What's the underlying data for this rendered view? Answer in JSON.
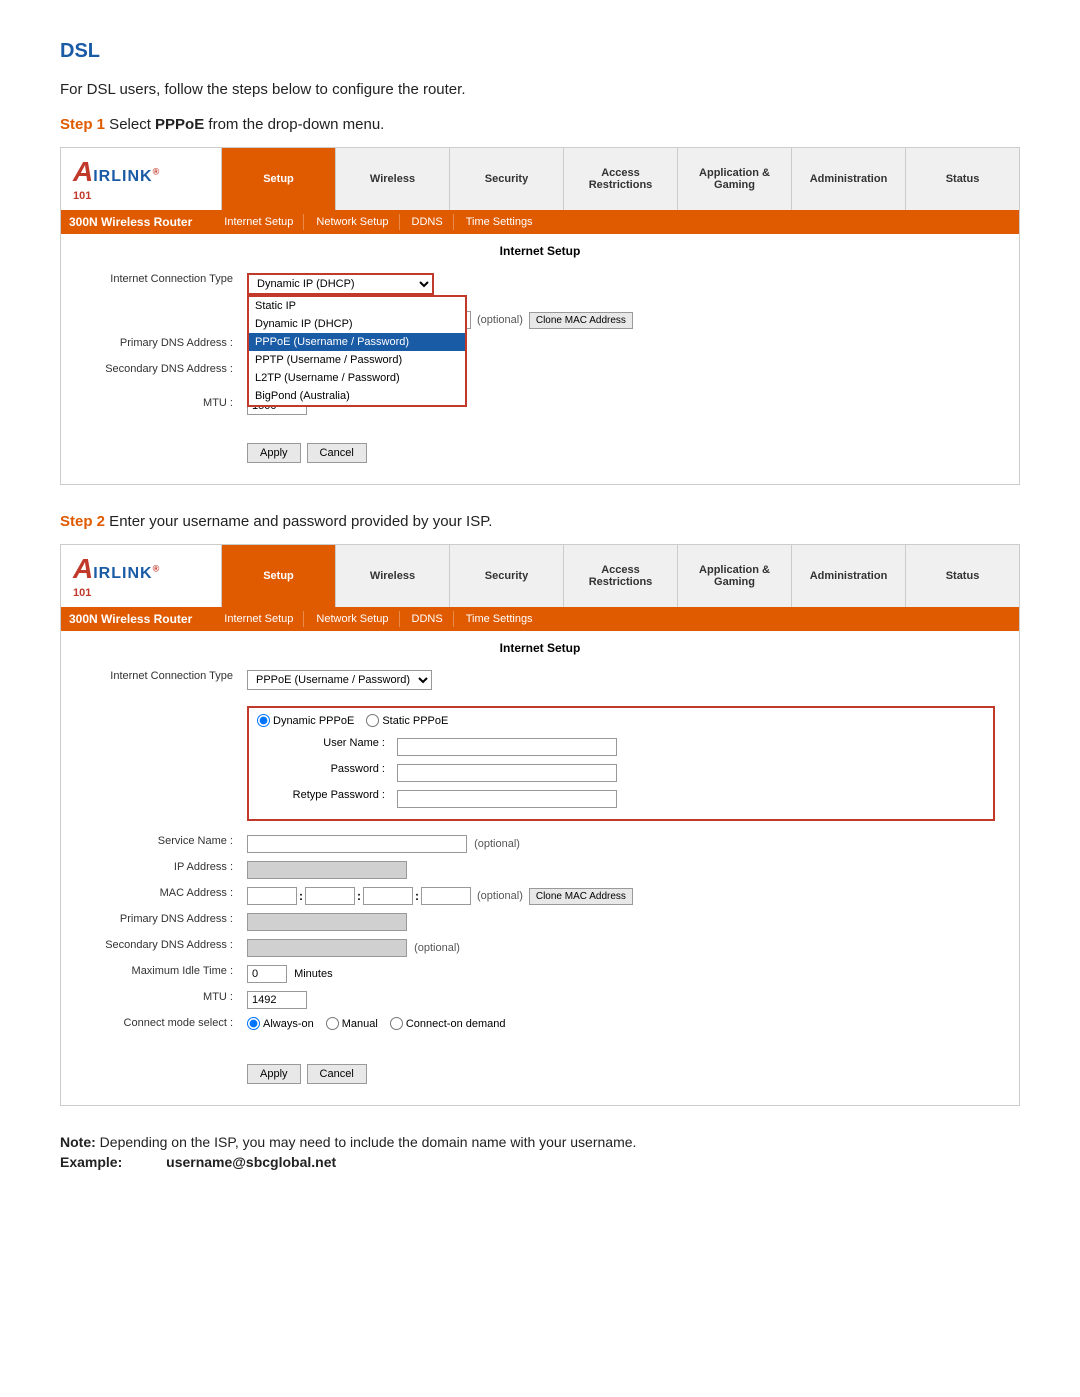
{
  "page": {
    "title": "DSL",
    "intro": "For DSL users, follow the steps below to configure the router.",
    "step1_label": "Step 1",
    "step1_text": " Select ",
    "step1_bold": "PPPoE",
    "step1_rest": " from the drop-down menu.",
    "step2_label": "Step 2",
    "step2_text": " Enter your username and password provided by your ISP.",
    "note_label": "Note:",
    "note_text": " Depending on the ISP, you may need to include the domain name with your username.",
    "example_label": "Example:",
    "example_value": "username@sbcglobal.net"
  },
  "logo": {
    "a": "A",
    "irlink": "IRLINK",
    "reg": "®",
    "num": "101"
  },
  "nav": {
    "items": [
      {
        "label": "Setup",
        "active": true
      },
      {
        "label": "Wireless",
        "active": false
      },
      {
        "label": "Security",
        "active": false
      },
      {
        "label": "Access\nRestrictions",
        "active": false
      },
      {
        "label": "Application &\nGaming",
        "active": false
      },
      {
        "label": "Administration",
        "active": false
      },
      {
        "label": "Status",
        "active": false
      }
    ]
  },
  "subnav": {
    "items": [
      "Internet Setup",
      "Network Setup",
      "DDNS",
      "Time Settings"
    ]
  },
  "brand": "300N Wireless Router",
  "section_title": "Internet Setup",
  "form1": {
    "label_connection": "Internet Connection Type",
    "dropdown_value": "Dynamic IP (DHCP)",
    "dropdown_options": [
      "Static IP",
      "Dynamic IP (DHCP)",
      "PPPoE (Username / Password)",
      "PPTP (Username / Password)",
      "L2TP (Username / Password)",
      "BigPond (Australia)"
    ],
    "highlighted_option": "PPPoE (Username / Password)",
    "label_mtu": "MTU :",
    "mtu_value": "1500",
    "label_primary_dns": "Primary DNS Address :",
    "label_secondary_dns": "Secondary DNS Address :",
    "optional": "(optional)",
    "btn_apply": "Apply",
    "btn_cancel": "Cancel",
    "btn_clone_mac": "Clone MAC Address"
  },
  "form2": {
    "label_connection": "Internet Connection Type",
    "dropdown_value": "PPPoE (Username / Password)",
    "radio_dynamic": "Dynamic PPPoE",
    "radio_static": "Static PPPoE",
    "label_username": "User Name :",
    "label_password": "Password :",
    "label_retype": "Retype Password :",
    "label_service": "Service Name :",
    "label_ip": "IP Address :",
    "label_mac": "MAC Address :",
    "label_primary_dns": "Primary DNS Address :",
    "label_secondary_dns": "Secondary DNS Address :",
    "label_max_idle": "Maximum Idle Time :",
    "label_mtu": "MTU :",
    "label_connect": "Connect mode select :",
    "radio_always": "Always-on",
    "radio_manual": "Manual",
    "radio_connect": "Connect-on demand",
    "mtu_value": "1492",
    "idle_value": "0",
    "optional": "(optional)",
    "minutes": "Minutes",
    "btn_apply": "Apply",
    "btn_cancel": "Cancel",
    "btn_clone_mac": "Clone MAC Address"
  }
}
